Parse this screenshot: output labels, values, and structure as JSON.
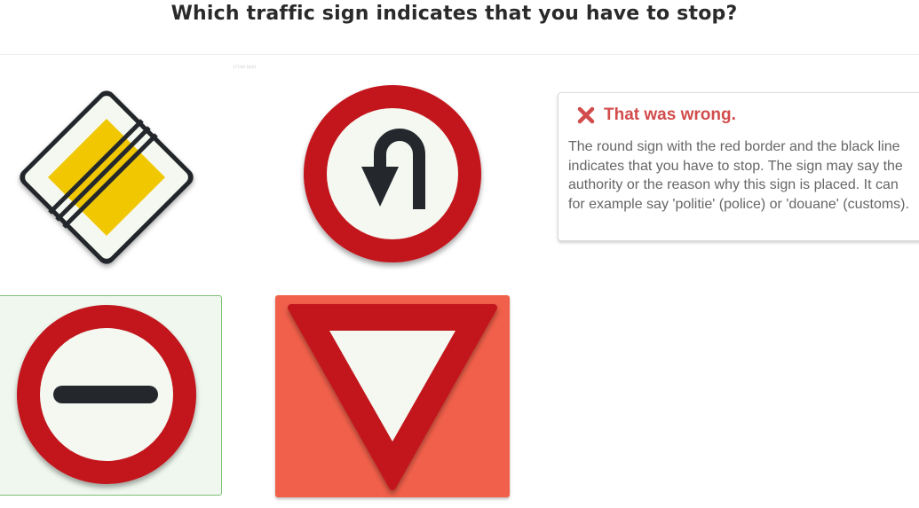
{
  "question": {
    "title": "Which traffic sign indicates that you have to stop?",
    "caption": "177/44 16/21"
  },
  "options": [
    {
      "sign": "priority-road-ends-icon",
      "state": "neutral"
    },
    {
      "sign": "no-u-turn-icon",
      "state": "neutral"
    },
    {
      "sign": "stop-at-line-icon",
      "state": "correct"
    },
    {
      "sign": "yield-icon",
      "state": "wrong-selected"
    }
  ],
  "feedback": {
    "title": "That was wrong.",
    "icon": "x-icon",
    "body": "The round sign with the red border and the black line indicates that you have to stop. The sign may say the authority or the reason why this sign is placed. It can for example say 'politie' (police) or 'douane' (customs)."
  },
  "colors": {
    "sign_red": "#c2141f",
    "sign_white": "#f4f8f1",
    "sign_yellow": "#f0c700",
    "sign_black": "#24272c",
    "correct_bg": "#eff7ee",
    "correct_border": "#7fc078",
    "wrong_bg": "#f1604a",
    "feedback_red": "#d24c4c"
  }
}
